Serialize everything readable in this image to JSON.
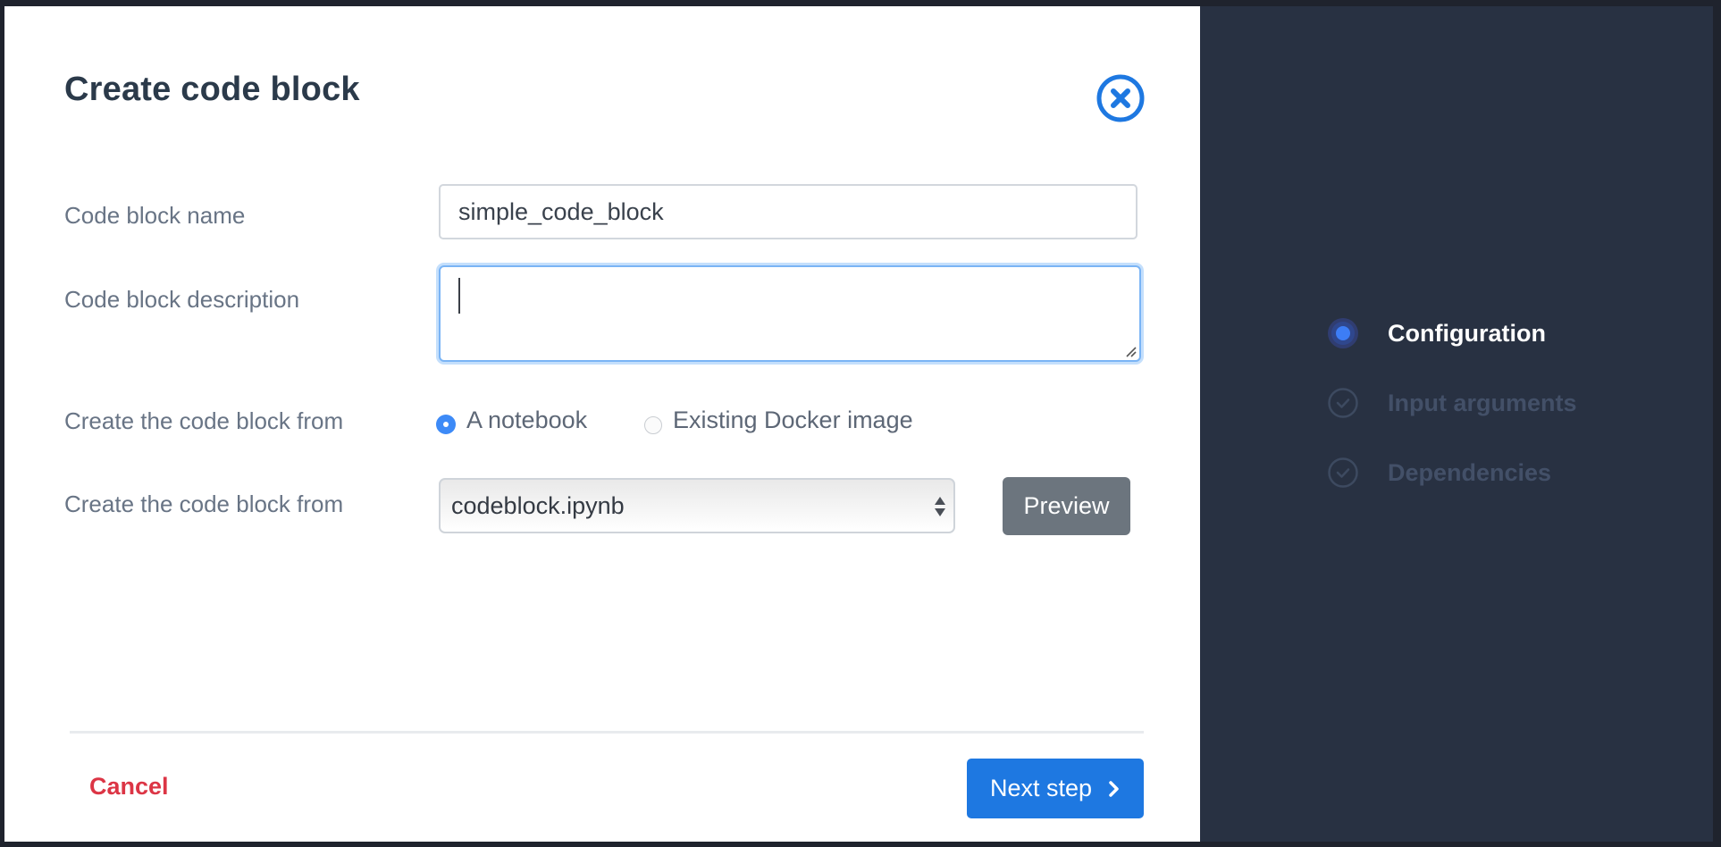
{
  "modal": {
    "title": "Create code block",
    "close_icon": "close-circle-icon"
  },
  "form": {
    "name": {
      "label": "Code block name",
      "value": "simple_code_block"
    },
    "description": {
      "label": "Code block description",
      "value": ""
    },
    "source_type": {
      "label": "Create the code block from",
      "options": [
        {
          "label": "A notebook",
          "selected": true
        },
        {
          "label": "Existing Docker image",
          "selected": false
        }
      ]
    },
    "source_file": {
      "label": "Create the code block from",
      "selected": "codeblock.ipynb"
    },
    "preview_label": "Preview"
  },
  "footer": {
    "cancel_label": "Cancel",
    "next_label": "Next step"
  },
  "steps": [
    {
      "label": "Configuration",
      "state": "active"
    },
    {
      "label": "Input arguments",
      "state": "pending"
    },
    {
      "label": "Dependencies",
      "state": "pending"
    }
  ],
  "colors": {
    "accent": "#1e78e1",
    "danger": "#dc3545",
    "sidebar": "#283142",
    "active_step": "#3d7df5"
  }
}
